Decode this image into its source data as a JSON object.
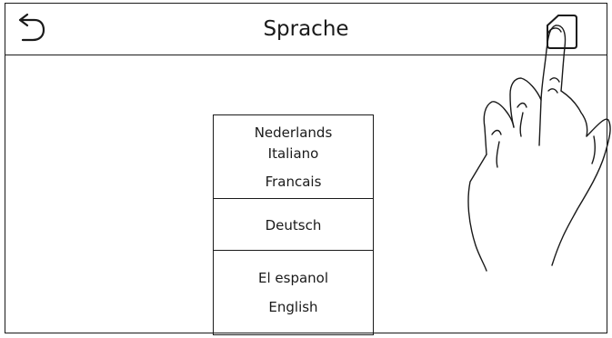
{
  "header": {
    "title": "Sprache",
    "back_icon": "back-arrow-icon",
    "home_icon": "home-icon"
  },
  "language_picker": {
    "options": [
      "Nederlands",
      "Italiano",
      "Francais",
      "Deutsch",
      "El espanol",
      "English"
    ],
    "selected": "Deutsch"
  },
  "overlay": {
    "icon": "tapping-hand-icon"
  }
}
